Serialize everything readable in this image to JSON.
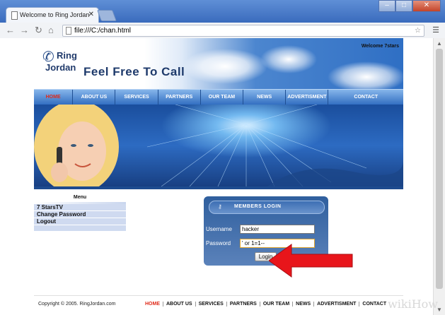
{
  "browser": {
    "tab_title": "Welcome to Ring Jordan",
    "tab_close": "✕",
    "url": "file:///C:/chan.html"
  },
  "site": {
    "logo_line1": "Ring",
    "logo_line2": "Jordan",
    "tagline": "Feel Free To Call",
    "welcome": "Welcome 7stars",
    "nav": [
      "HOME",
      "ABOUT US",
      "SERVICES",
      "PARTNERS",
      "OUR TEAM",
      "NEWS",
      "ADVERTISMENT",
      "CONTACT"
    ],
    "menu_title": "Menu",
    "menu_items": [
      "7 StarsTV",
      "Change Password",
      "Logout"
    ],
    "login": {
      "title": "MEMBERS LOGIN",
      "username_label": "Username",
      "username_value": "hacker",
      "password_label": "Password",
      "password_value": "' or 1=1--",
      "button": "Login"
    },
    "footer": {
      "copyright": "Copyright © 2005. RingJordan.com",
      "links": [
        "HOME",
        "ABOUT US",
        "SERVICES",
        "PARTNERS",
        "OUR TEAM",
        "NEWS",
        "ADVERTISMENT",
        "CONTACT"
      ]
    }
  },
  "watermark": "wikiHow",
  "colors": {
    "nav_active": "#e02b1a",
    "arrow": "#e8151b",
    "nav_bar": "#2f6cc0"
  }
}
